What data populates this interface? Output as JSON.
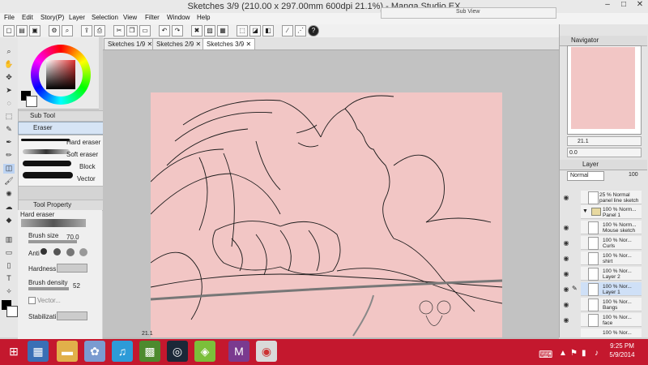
{
  "window": {
    "title": "Sketches 3/9 (210.00 x 297.00mm 600dpi 21.1%)  - Manga Studio EX",
    "subview_title": "Sub View"
  },
  "menu": [
    "File",
    "Edit",
    "Story(P)",
    "Layer",
    "Selection",
    "View",
    "Filter",
    "Window",
    "Help"
  ],
  "tabs": [
    "Sketches 1/9",
    "Sketches 2/9",
    "Sketches 3/9"
  ],
  "subtool": {
    "title": "Sub Tool",
    "active_tab": "Eraser",
    "items": [
      "Hard eraser",
      "Soft eraser",
      "Block",
      "Vector"
    ]
  },
  "toolproperty": {
    "title": "Tool Property",
    "tool_name": "Hard eraser",
    "brush_size_label": "Brush size",
    "brush_size": "70.0",
    "antialias_label": "Anti",
    "hardness_label": "Hardness",
    "brush_density_label": "Brush density",
    "brush_density": "52",
    "vector_label": "Vector...",
    "stabilization_label": "Stabilizati"
  },
  "navigator": {
    "title": "Navigator",
    "zoom": "21.1",
    "rotation": "0.0"
  },
  "layer": {
    "title": "Layer",
    "blend_mode": "Normal",
    "opacity": "100",
    "rows": [
      {
        "pct": "25 %",
        "mode": "Normal",
        "name": "panel line sketch"
      },
      {
        "pct": "100 %",
        "mode": "Norm...",
        "name": "Panel 1"
      },
      {
        "pct": "100 %",
        "mode": "Norm...",
        "name": "Mouse sketch"
      },
      {
        "pct": "100 %",
        "mode": "Nor...",
        "name": "Curls"
      },
      {
        "pct": "100 %",
        "mode": "Nor...",
        "name": "shirt"
      },
      {
        "pct": "100 %",
        "mode": "Nor...",
        "name": "Layer 2"
      },
      {
        "pct": "100 %",
        "mode": "Nor...",
        "name": "Layer 1"
      },
      {
        "pct": "100 %",
        "mode": "Nor...",
        "name": "Bangs"
      },
      {
        "pct": "100 %",
        "mode": "Nor...",
        "name": "face"
      },
      {
        "pct": "100 %",
        "mode": "Nor...",
        "name": ""
      }
    ]
  },
  "statusbar": {
    "zoom": "21.1"
  },
  "colors": {
    "canvas": "#f2c6c5",
    "taskbar": "#c4182e"
  },
  "clock": {
    "time": "9:25 PM",
    "date": "5/9/2014"
  }
}
